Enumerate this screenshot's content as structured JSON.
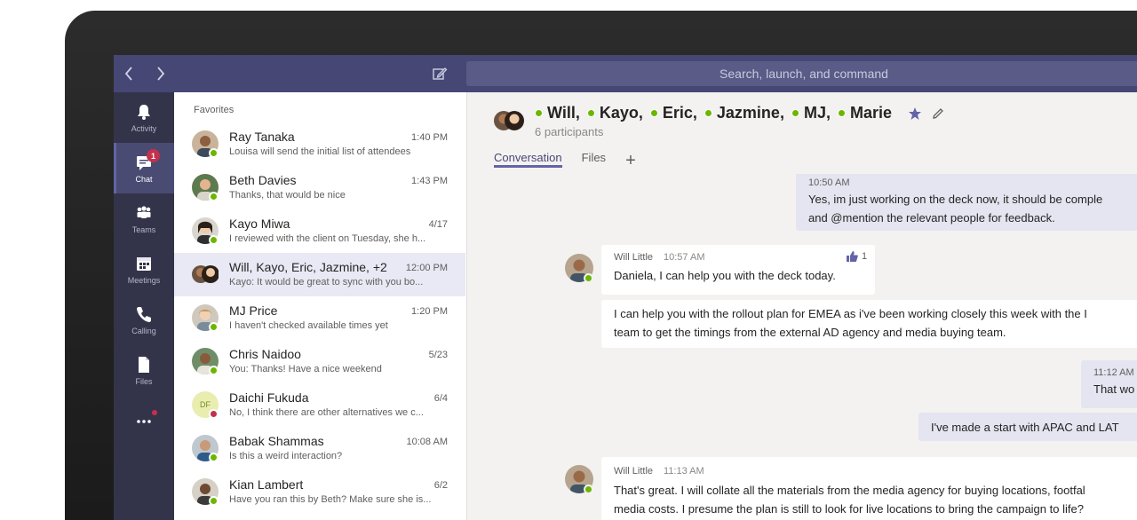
{
  "topbar": {
    "search_placeholder": "Search, launch, and command"
  },
  "rail": [
    {
      "label": "Activity",
      "icon": "bell-icon"
    },
    {
      "label": "Chat",
      "icon": "chat-icon",
      "badge": "1"
    },
    {
      "label": "Teams",
      "icon": "teams-icon"
    },
    {
      "label": "Meetings",
      "icon": "calendar-icon"
    },
    {
      "label": "Calling",
      "icon": "phone-icon"
    },
    {
      "label": "Files",
      "icon": "file-icon"
    }
  ],
  "chatlist": {
    "favorites_label": "Favorites",
    "items": [
      {
        "name": "Ray Tanaka",
        "time": "1:40 PM",
        "preview": "Louisa will send the initial list of attendees",
        "presence": "available"
      },
      {
        "name": "Beth Davies",
        "time": "1:43 PM",
        "preview": "Thanks, that would be nice",
        "presence": "available"
      },
      {
        "name": "Kayo Miwa",
        "time": "4/17",
        "preview": "I reviewed with the client on Tuesday, she h...",
        "presence": "available"
      },
      {
        "name": "Will, Kayo, Eric, Jazmine, +2",
        "time": "12:00 PM",
        "preview": "Kayo: It would be great to sync with you bo...",
        "presence": "group"
      },
      {
        "name": "MJ Price",
        "time": "1:20 PM",
        "preview": "I haven't checked available times yet",
        "presence": "available"
      },
      {
        "name": "Chris Naidoo",
        "time": "5/23",
        "preview": "You: Thanks! Have a nice weekend",
        "presence": "available"
      },
      {
        "name": "Daichi Fukuda",
        "time": "6/4",
        "preview": "No, I think there are other alternatives we c...",
        "presence": "busy",
        "initials": "DF"
      },
      {
        "name": "Babak Shammas",
        "time": "10:08 AM",
        "preview": "Is this a weird interaction?",
        "presence": "available"
      },
      {
        "name": "Kian Lambert",
        "time": "6/2",
        "preview": "Have you ran this by Beth? Make sure she is...",
        "presence": "available"
      }
    ]
  },
  "conversation": {
    "participants": [
      "Will,",
      "Kayo,",
      "Eric,",
      "Jazmine,",
      "MJ,",
      "Marie"
    ],
    "subtitle": "6 participants",
    "tabs": [
      "Conversation",
      "Files"
    ],
    "messages": {
      "m1": {
        "time": "10:50 AM",
        "line1": "Yes, im just working on the deck now, it should be comple",
        "line2": "and @mention the relevant people for feedback."
      },
      "m2": {
        "sender": "Will Little",
        "time": "10:57 AM",
        "text": "Daniela, I can help you with the deck today.",
        "likes": "1"
      },
      "m3": {
        "line1": "I can help you with the rollout plan for EMEA as i've been working closely this week with the I",
        "line2": "team to get the timings from the external AD agency and media buying team."
      },
      "m4": {
        "time": "11:12 AM",
        "text": "That wo"
      },
      "m5": {
        "text": "I've made a start with APAC and LAT"
      },
      "m6": {
        "sender": "Will Little",
        "time": "11:13 AM",
        "line1": "That's great. I will collate all the materials from the media agency for buying locations, footfal",
        "line2": "media costs. I presume the plan is still to look for live locations to bring the campaign to life?"
      }
    }
  },
  "colors": {
    "topbar": "#464775",
    "rail": "#33344a",
    "accent": "#6264a7",
    "available": "#6bb700",
    "busy": "#c4314b"
  }
}
